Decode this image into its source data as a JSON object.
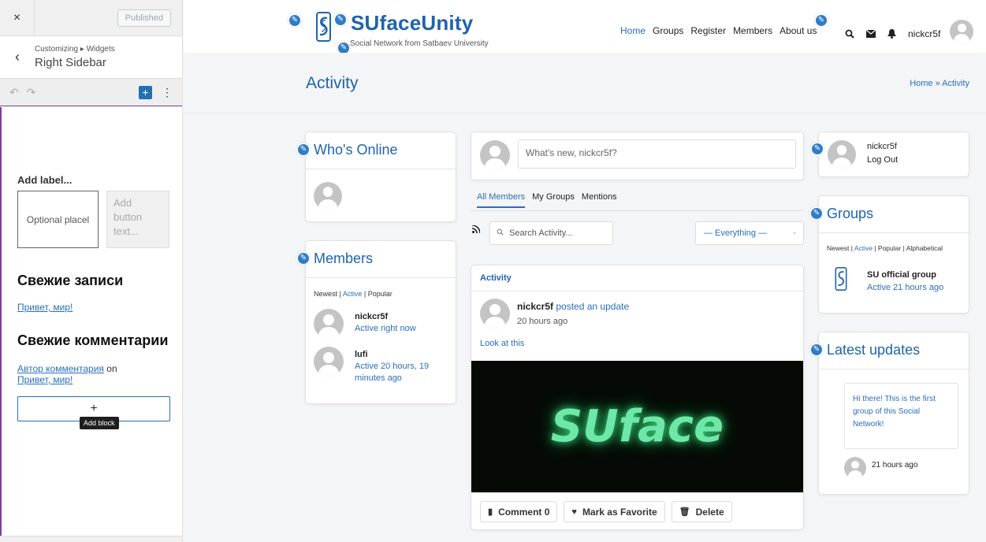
{
  "customizer": {
    "close_icon": "×",
    "published_label": "Published",
    "back_icon": "‹",
    "breadcrumb": "Customizing ▸ Widgets",
    "section_title": "Right Sidebar",
    "undo_icon": "↶",
    "redo_icon": "↷",
    "add_icon": "+",
    "more_icon": "⋮",
    "form_label": "Add label...",
    "input_placeholder": "Optional placel",
    "button_text": "Add button text...",
    "recent_posts_heading": "Свежие записи",
    "recent_post_link": "Привет, мир!",
    "recent_comments_heading": "Свежие комментарии",
    "comment_author": "Автор комментария",
    "comment_on": "on",
    "comment_post": "Привет, мир!",
    "add_block_icon": "+",
    "add_block_tooltip": "Add block"
  },
  "header": {
    "logo_text": "SUfaceUnity",
    "tagline": "Social Network from Satbaev University",
    "nav": [
      {
        "label": "Home",
        "active": true
      },
      {
        "label": "Groups"
      },
      {
        "label": "Register"
      },
      {
        "label": "Members"
      },
      {
        "label": "About us"
      }
    ],
    "search_icon": "🔍",
    "mail_icon": "✉",
    "bell_icon": "🔔",
    "username": "nickcr5f",
    "brand_color": "#1f63ad"
  },
  "page": {
    "title": "Activity",
    "breadcrumb": "Home » Activity"
  },
  "whos_online": {
    "title": "Who's Online"
  },
  "members": {
    "title": "Members",
    "filter_newest": "Newest",
    "filter_active": "Active",
    "filter_popular": "Popular",
    "list": [
      {
        "name": "nickcr5f",
        "activity": "Active right now"
      },
      {
        "name": "lufi",
        "activity": "Active 20 hours, 19 minutes ago"
      }
    ]
  },
  "activity": {
    "post_placeholder": "What's new, nickcr5f?",
    "tabs": [
      "All Members",
      "My Groups",
      "Mentions"
    ],
    "rss_icon": "rss-icon",
    "search_placeholder": "Search Activity...",
    "filter_value": "— Everything —",
    "stream_header": "Activity",
    "entry": {
      "user": "nickcr5f",
      "action": "posted an update",
      "time": "20 hours ago",
      "text": "Look at this",
      "image_text": "SUface"
    },
    "comment_label": "Comment 0",
    "favorite_label": "Mark as Favorite",
    "delete_label": "Delete"
  },
  "user_widget": {
    "name": "nickcr5f",
    "logout": "Log Out"
  },
  "groups": {
    "title": "Groups",
    "filter_newest": "Newest",
    "filter_active": "Active",
    "filter_popular": "Popular",
    "filter_alpha": "Alphabetical",
    "group_name": "SU official group",
    "group_activity": "Active 21 hours ago"
  },
  "latest_updates": {
    "title": "Latest updates",
    "message": "Hi there! This is the first group of this Social Network!",
    "time": "21 hours ago"
  }
}
